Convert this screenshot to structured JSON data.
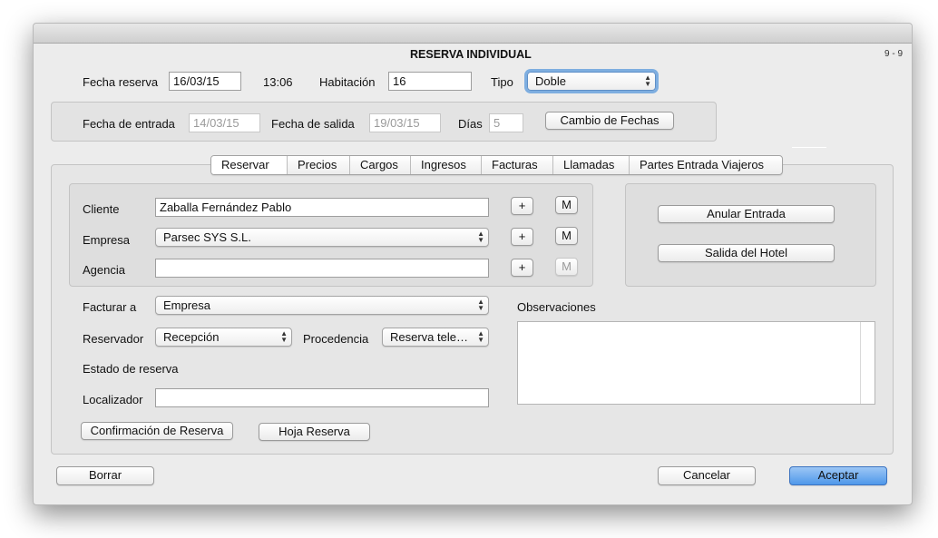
{
  "window": {
    "title": "RESERVA INDIVIDUAL",
    "page_indicator": "9 - 9"
  },
  "header": {
    "fecha_reserva_label": "Fecha reserva",
    "fecha_reserva_value": "16/03/15",
    "hora": "13:06",
    "habitacion_label": "Habitación",
    "habitacion_value": "16",
    "tipo_label": "Tipo",
    "tipo_value": "Doble"
  },
  "dates": {
    "entrada_label": "Fecha de entrada",
    "entrada_value": "14/03/15",
    "salida_label": "Fecha de salida",
    "salida_value": "19/03/15",
    "dias_label": "Días",
    "dias_value": "5",
    "cambio_button": "Cambio de Fechas"
  },
  "tabs": [
    "Reservar",
    "Precios",
    "Cargos",
    "Ingresos",
    "Facturas",
    "Llamadas",
    "Partes Entrada Viajeros"
  ],
  "client": {
    "cliente_label": "Cliente",
    "cliente_value": "Zaballa Fernández Pablo",
    "empresa_label": "Empresa",
    "empresa_value": "Parsec SYS S.L.",
    "agencia_label": "Agencia",
    "agencia_value": "",
    "add_label": "+",
    "modify_label": "M"
  },
  "actions": {
    "anular_button": "Anular Entrada",
    "salida_button": "Salida del Hotel"
  },
  "billing": {
    "facturar_label": "Facturar a",
    "facturar_value": "Empresa",
    "reservador_label": "Reservador",
    "reservador_value": "Recepción",
    "procedencia_label": "Procedencia",
    "procedencia_value": "Reserva tele…",
    "estado_label": "Estado de reserva",
    "localizador_label": "Localizador",
    "localizador_value": "",
    "confirmacion_button": "Confirmación de Reserva",
    "hoja_button": "Hoja Reserva",
    "observaciones_label": "Observaciones",
    "observaciones_value": ""
  },
  "footer": {
    "borrar": "Borrar",
    "cancelar": "Cancelar",
    "aceptar": "Aceptar"
  },
  "colors": {
    "accent": "#4f98ea",
    "window_bg": "#ececec",
    "group_bg": "#e3e3e3"
  }
}
